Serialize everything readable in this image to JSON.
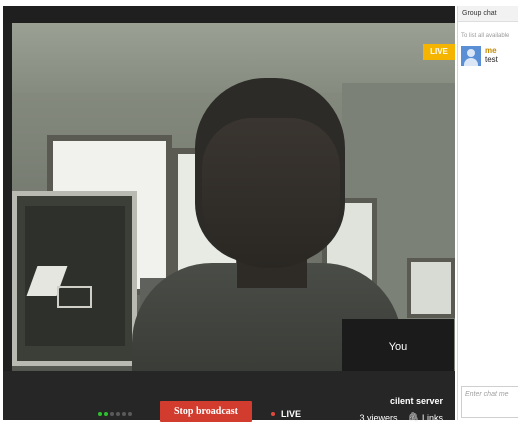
{
  "live_badge": "LIVE",
  "self_view": {
    "label": "You"
  },
  "controls": {
    "signal_dots": [
      "#2ec02e",
      "#2ec02e",
      "#5a5a5a",
      "#5a5a5a",
      "#5a5a5a",
      "#5a5a5a"
    ],
    "stop_button": "Stop broadcast",
    "live_indicator": "LIVE",
    "server_name": "cilent server",
    "viewers": "3 viewers",
    "links": "Links",
    "links_icon": "link-icon"
  },
  "chat": {
    "header": "Group chat",
    "hint": "To list all available",
    "messages": [
      {
        "sender": "me",
        "text": "test",
        "avatar": "user-avatar-icon"
      }
    ],
    "input_placeholder": "Enter chat me"
  },
  "colors": {
    "stop_button": "#d23c2e",
    "live_badge": "#f4b400",
    "live_dot": "#e04a3c",
    "sender_name": "#c48a00",
    "avatar": "#5a8fd6"
  }
}
